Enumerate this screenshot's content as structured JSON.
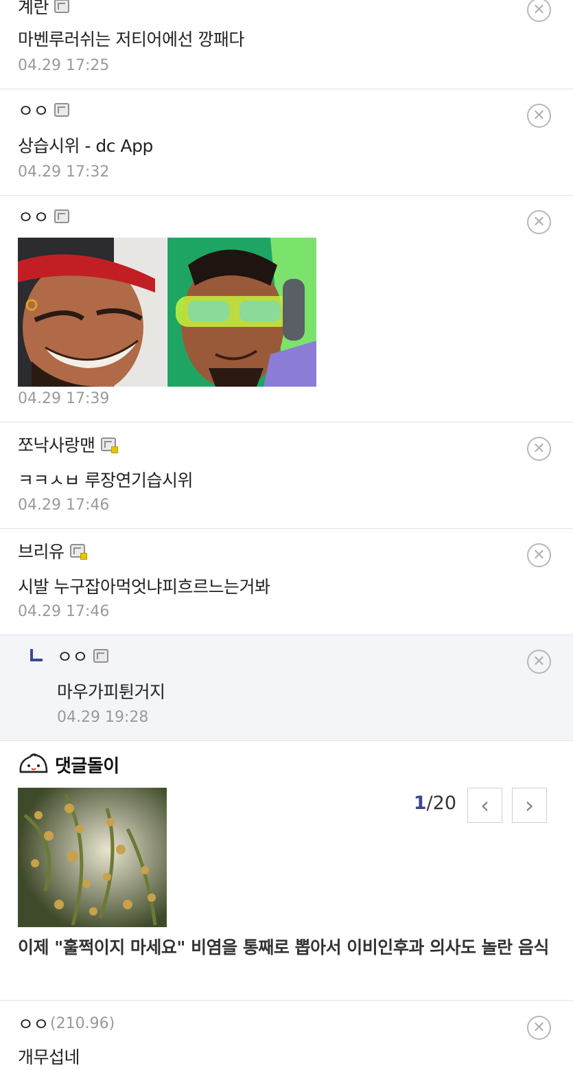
{
  "comments": [
    {
      "nick": "계란",
      "text": "마벤루러쉬는 저티어에선 깡패다",
      "date": "04.29 17:25"
    },
    {
      "nick": "ㅇㅇ",
      "text": "상습시위 - dc App",
      "date": "04.29 17:32"
    },
    {
      "nick": "ㅇㅇ",
      "text": "",
      "date": "04.29 17:39"
    },
    {
      "nick": "쪼낙사랑맨",
      "text": "ㅋㅋㅅㅂ 루장연기습시위",
      "date": "04.29 17:46"
    },
    {
      "nick": "브리유",
      "text": "시발 누구잡아먹엇냐피흐르느는거봐",
      "date": "04.29 17:46"
    },
    {
      "nick": "ㅇㅇ",
      "text": "마우가피튄거지",
      "date": "04.29 19:28"
    },
    {
      "nick": "ㅇㅇ",
      "ip": "(210.96)",
      "text": "개무섭네"
    }
  ],
  "dc_section": {
    "title": "댓글돌이",
    "page_current": "1",
    "page_total": "/20",
    "headline": "이제 \"훌쩍이지 마세요\" 비염을 통째로 뽑아서 이비인후과 의사도 놀란 음식"
  },
  "icons": {
    "delete": "close-circle-icon",
    "gallog": "gallog-icon",
    "reply": "reply-arrow-icon",
    "prev": "chevron-left-icon",
    "next": "chevron-right-icon",
    "mascot": "dcbot-mascot-icon"
  },
  "colors": {
    "accent": "#3b4890",
    "reply_bg": "#f3f5f9",
    "date": "#9a9a9a"
  }
}
